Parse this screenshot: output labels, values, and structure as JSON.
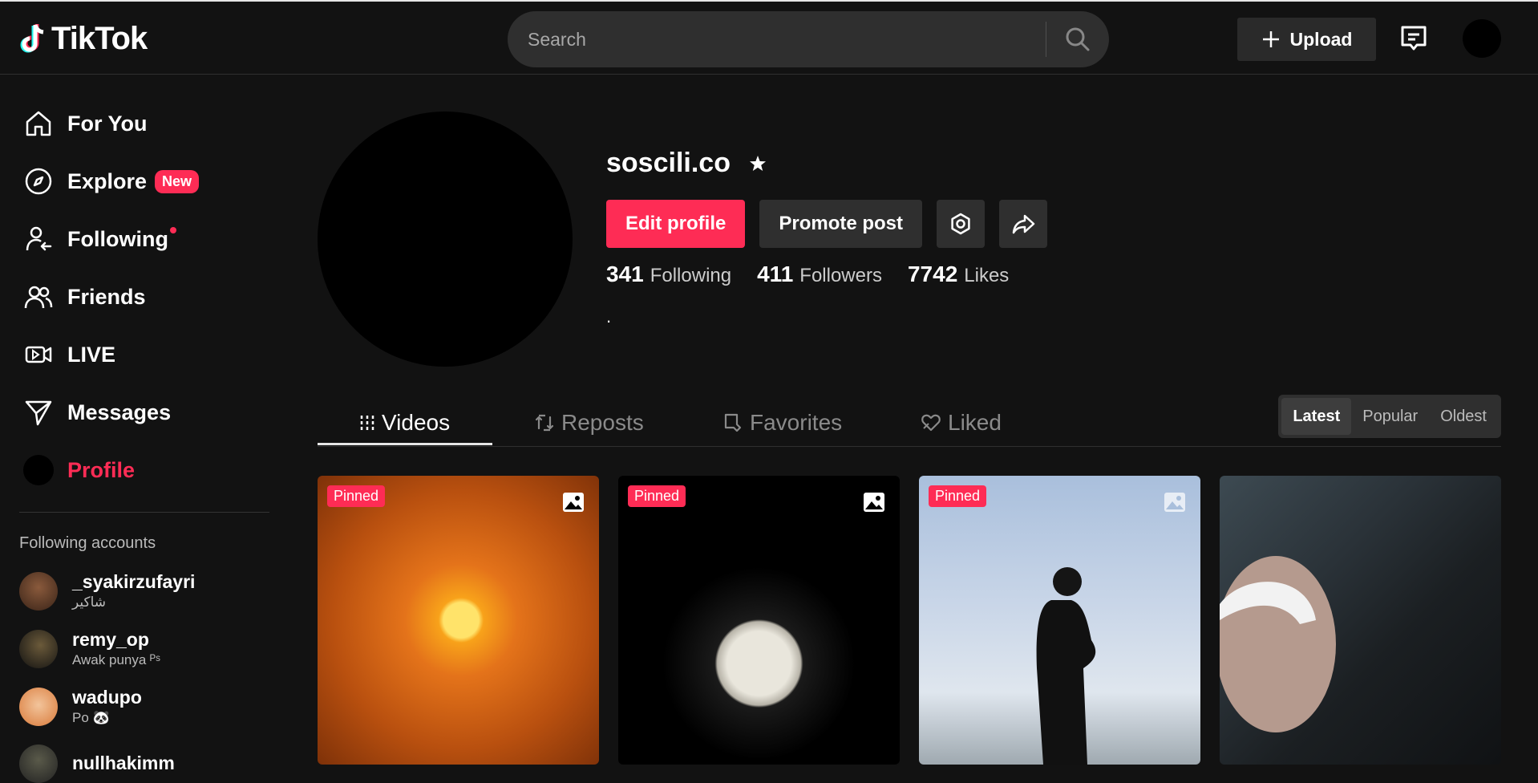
{
  "header": {
    "logo_text": "TikTok",
    "search_placeholder": "Search",
    "upload_label": "Upload"
  },
  "sidebar": {
    "items": [
      {
        "label": "For You",
        "icon": "home-icon"
      },
      {
        "label": "Explore",
        "icon": "compass-icon",
        "badge": "New"
      },
      {
        "label": "Following",
        "icon": "following-icon"
      },
      {
        "label": "Friends",
        "icon": "friends-icon"
      },
      {
        "label": "LIVE",
        "icon": "live-icon"
      },
      {
        "label": "Messages",
        "icon": "messages-icon"
      },
      {
        "label": "Profile",
        "icon": "profile-avatar"
      }
    ],
    "following_header": "Following accounts",
    "accounts": [
      {
        "name": "_syakirzufayri",
        "sub": "شاكير"
      },
      {
        "name": "remy_op",
        "sub": "Awak punya ᴾˢ"
      },
      {
        "name": "wadupo",
        "sub": "Po 🐼"
      },
      {
        "name": "nullhakimm",
        "sub": ""
      }
    ]
  },
  "profile": {
    "username": "soscili.co",
    "edit_label": "Edit profile",
    "promote_label": "Promote post",
    "stats": [
      {
        "value": "341",
        "label": "Following"
      },
      {
        "value": "411",
        "label": "Followers"
      },
      {
        "value": "7742",
        "label": "Likes"
      }
    ],
    "bio": "."
  },
  "tabs": [
    "Videos",
    "Reposts",
    "Favorites",
    "Liked"
  ],
  "sort_options": [
    "Latest",
    "Popular",
    "Oldest"
  ],
  "videos": [
    {
      "pinned": "Pinned"
    },
    {
      "pinned": "Pinned"
    },
    {
      "pinned": "Pinned"
    },
    {
      "pinned": ""
    }
  ],
  "colors": {
    "accent": "#fe2c55",
    "background": "#121212",
    "surface": "#2f2f2f"
  }
}
